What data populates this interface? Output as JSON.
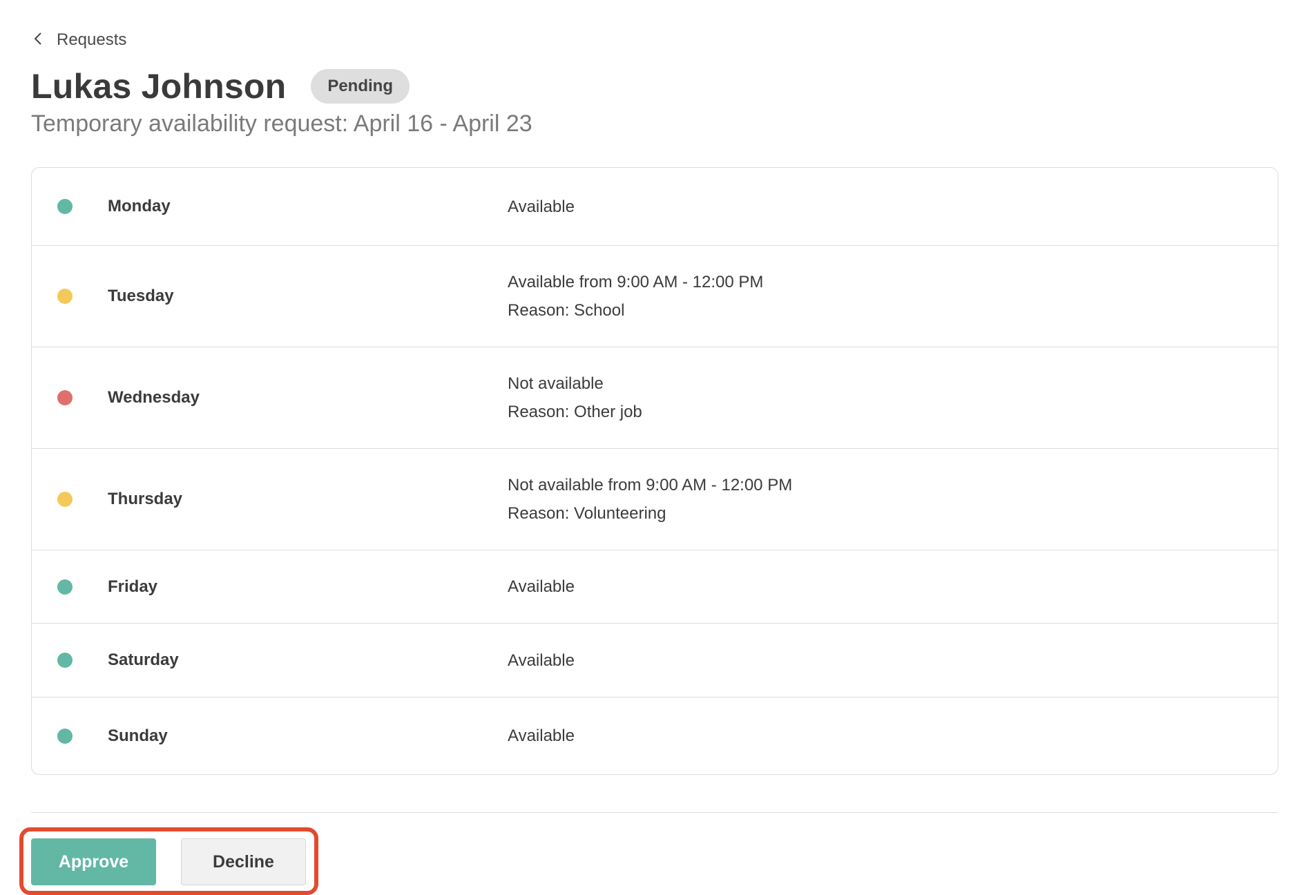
{
  "nav": {
    "back_label": "Requests"
  },
  "header": {
    "name": "Lukas Johnson",
    "status": "Pending",
    "subtitle": "Temporary availability request: April 16 - April 23"
  },
  "colors": {
    "available": "#62b8a5",
    "partial": "#f5c85a",
    "unavailable": "#e06f6c"
  },
  "days": [
    {
      "day": "Monday",
      "status": "available",
      "lines": [
        "Available"
      ]
    },
    {
      "day": "Tuesday",
      "status": "partial",
      "lines": [
        "Available from 9:00 AM - 12:00 PM",
        "Reason: School"
      ]
    },
    {
      "day": "Wednesday",
      "status": "unavailable",
      "lines": [
        "Not available",
        "Reason: Other job"
      ]
    },
    {
      "day": "Thursday",
      "status": "partial",
      "lines": [
        "Not available from 9:00 AM - 12:00 PM",
        "Reason: Volunteering"
      ]
    },
    {
      "day": "Friday",
      "status": "available",
      "lines": [
        "Available"
      ]
    },
    {
      "day": "Saturday",
      "status": "available",
      "lines": [
        "Available"
      ]
    },
    {
      "day": "Sunday",
      "status": "available",
      "lines": [
        "Available"
      ]
    }
  ],
  "actions": {
    "approve_label": "Approve",
    "decline_label": "Decline"
  }
}
